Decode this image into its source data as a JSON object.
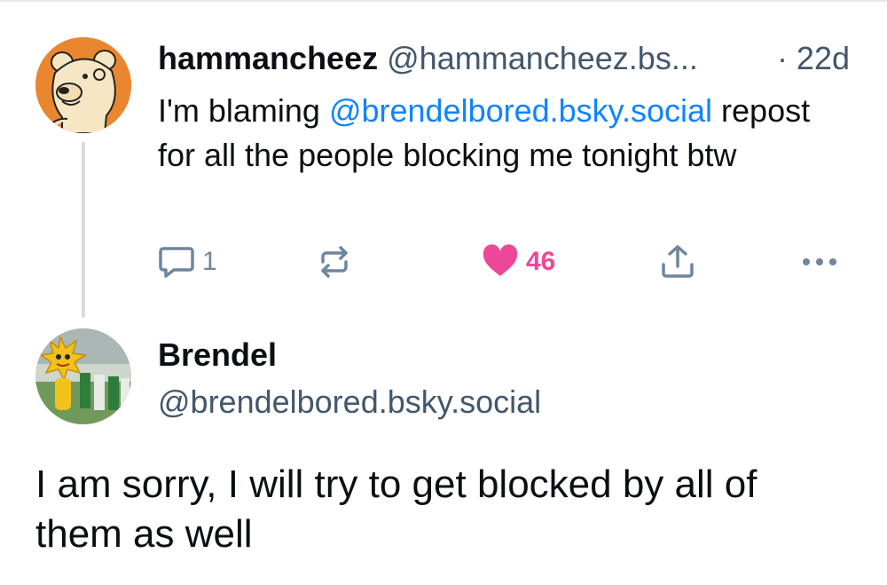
{
  "parent_post": {
    "display_name": "hammancheez",
    "handle": "@hammancheez.bs...",
    "time": "· 22d",
    "text_before": "I'm blaming ",
    "mention": "@brendelbored.bsky.social",
    "text_after": " repost for all the people blocking me tonight btw",
    "reply_count": "1",
    "like_count": "46",
    "avatar_icon": "cartoon-bear-avatar"
  },
  "focus_post": {
    "display_name": "Brendel",
    "handle": "@brendelbored.bsky.social",
    "text": "I am sorry, I will try to get blocked by all of them as well",
    "avatar_icon": "mascot-photo-avatar"
  },
  "colors": {
    "mention": "#1083fe",
    "like": "#ec4899",
    "muted": "#42576c",
    "icon": "#6f869f"
  }
}
